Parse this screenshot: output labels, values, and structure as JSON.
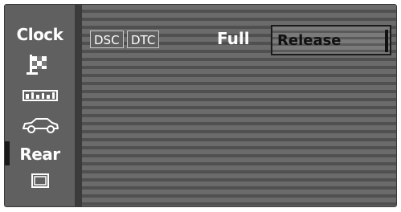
{
  "sidebar": {
    "items": [
      {
        "label": "Clock",
        "icon": "clock-label"
      },
      {
        "icon": "flag-icon"
      },
      {
        "icon": "tire-pressure-icon"
      },
      {
        "icon": "car-icon"
      },
      {
        "label": "Rear",
        "icon": "rear-label"
      },
      {
        "icon": "screen-icon"
      }
    ]
  },
  "header": {
    "dsc_label": "DSC",
    "dtc_label": "DTC",
    "full_label": "Full",
    "release_label": "Release"
  }
}
